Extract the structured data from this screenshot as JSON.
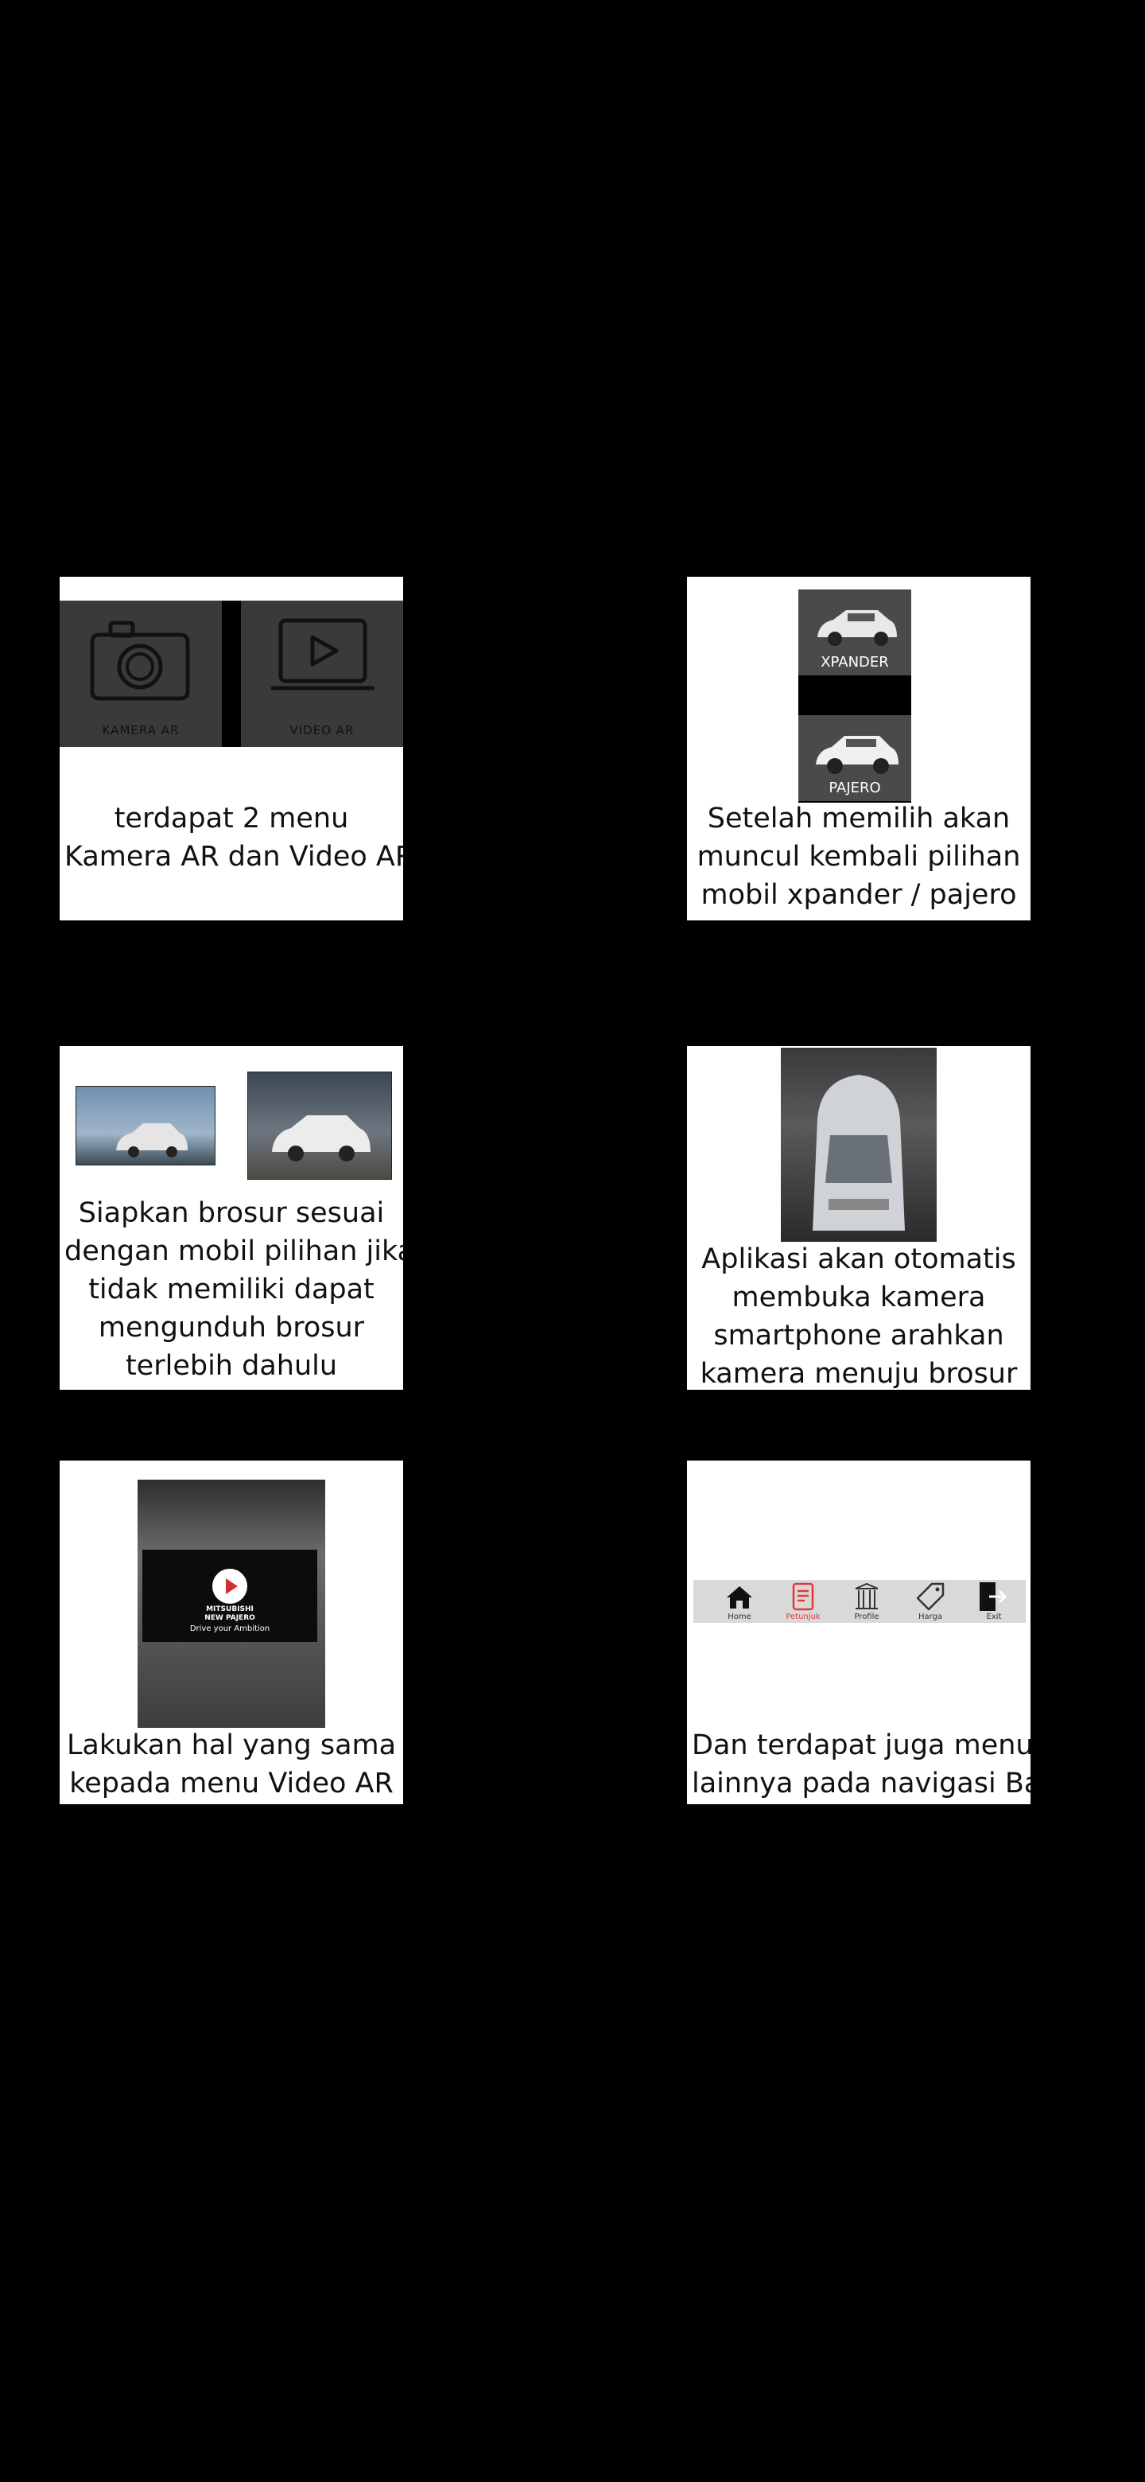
{
  "cards": [
    {
      "caption": [
        "terdapat 2 menu",
        "Kamera AR dan Video AR"
      ],
      "menus": [
        {
          "label": "KAMERA AR",
          "icon": "camera-icon"
        },
        {
          "label": "VIDEO AR",
          "icon": "monitor-play-icon"
        }
      ]
    },
    {
      "caption": [
        "Setelah memilih akan",
        "muncul kembali pilihan",
        "mobil xpander / pajero"
      ],
      "cars": [
        {
          "label": "XPANDER"
        },
        {
          "label": "PAJERO"
        }
      ]
    },
    {
      "caption": [
        "Siapkan brosur sesuai",
        "dengan mobil pilihan jika",
        "tidak memiliki dapat",
        "mengunduh brosur",
        "terlebih dahulu"
      ]
    },
    {
      "caption": [
        "Aplikasi akan otomatis",
        "membuka kamera",
        "smartphone arahkan",
        "kamera menuju brosur"
      ]
    },
    {
      "caption": [
        "Lakukan hal yang sama",
        "kepada menu Video AR"
      ],
      "video": {
        "brand": "MITSUBISHI",
        "model": "NEW PAJERO",
        "tagline": "Drive your Ambition"
      }
    },
    {
      "caption": [
        "Dan terdapat juga menu",
        "lainnya pada navigasi Bar"
      ],
      "nav": [
        {
          "label": "Home",
          "icon": "home-icon"
        },
        {
          "label": "Petunjuk",
          "icon": "guide-icon",
          "active": true
        },
        {
          "label": "Profile",
          "icon": "building-icon"
        },
        {
          "label": "Harga",
          "icon": "price-tag-icon"
        },
        {
          "label": "Exit",
          "icon": "exit-icon"
        }
      ]
    }
  ],
  "colors": {
    "background": "#000000",
    "card": "#ffffff",
    "active": "#e53935"
  }
}
